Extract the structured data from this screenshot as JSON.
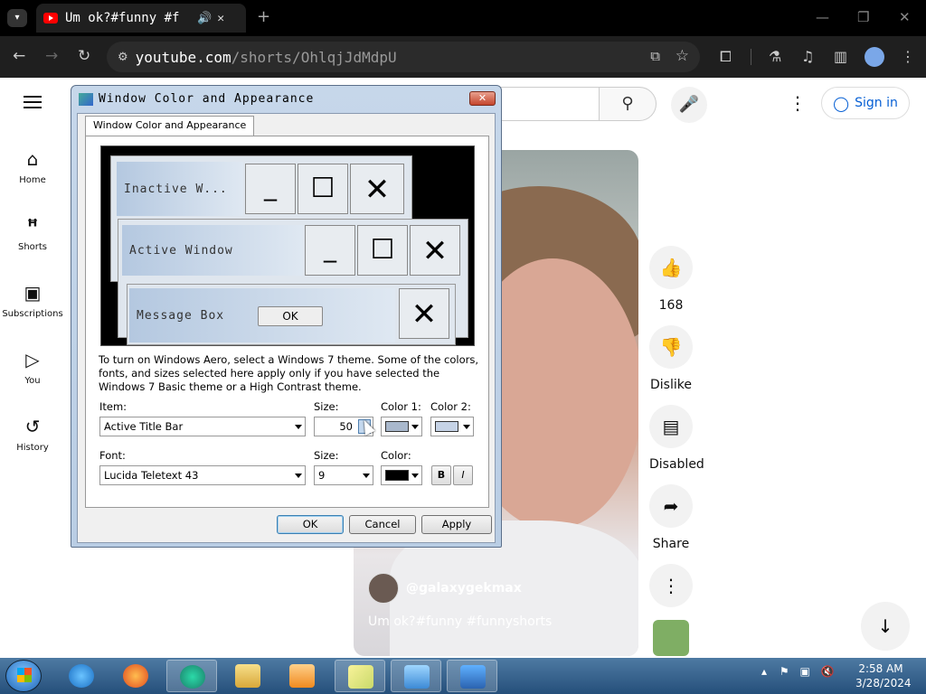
{
  "browser": {
    "tab_title": "Um ok?#funny #f",
    "url_host": "youtube.com",
    "url_path": "/shorts/OhlqjJdMdpU",
    "new_tab": "+",
    "controls": {
      "min": "—",
      "max": "❐",
      "close": "✕"
    }
  },
  "youtube": {
    "sidebar": [
      {
        "label": "Home",
        "icon": "home-icon"
      },
      {
        "label": "Shorts",
        "icon": "shorts-icon"
      },
      {
        "label": "Subscriptions",
        "icon": "subscriptions-icon"
      },
      {
        "label": "You",
        "icon": "you-icon"
      },
      {
        "label": "History",
        "icon": "history-icon"
      }
    ],
    "sign_in": "Sign in",
    "channel": "@galaxygekmax",
    "caption": "Um ok?#funny #funnyshorts",
    "actions": {
      "likes": "168",
      "dislike": "Dislike",
      "comments": "Disabled",
      "share": "Share"
    }
  },
  "dialog": {
    "title": "Window Color and Appearance",
    "tab": "Window Color and Appearance",
    "preview": {
      "inactive": "Inactive W...",
      "active": "Active Window",
      "message": "Message Box",
      "ok": "OK"
    },
    "info": "To turn on Windows Aero, select a Windows 7 theme.  Some of the colors, fonts, and sizes selected here apply only if you have selected the Windows 7 Basic theme or a High Contrast theme.",
    "item_label": "Item:",
    "item_value": "Active Title Bar",
    "size_label": "Size:",
    "size_value": "50",
    "color1_label": "Color 1:",
    "color2_label": "Color 2:",
    "font_label": "Font:",
    "font_value": "Lucida Teletext 43",
    "font_size_label": "Size:",
    "font_size_value": "9",
    "color_label": "Color:",
    "bold": "B",
    "italic": "I",
    "ok": "OK",
    "cancel": "Cancel",
    "apply": "Apply",
    "colors": {
      "color1": "#a9b8cc",
      "color2": "#c6d3e6",
      "font_color": "#000000"
    }
  },
  "taskbar": {
    "time": "2:58 AM",
    "date": "3/28/2024"
  }
}
